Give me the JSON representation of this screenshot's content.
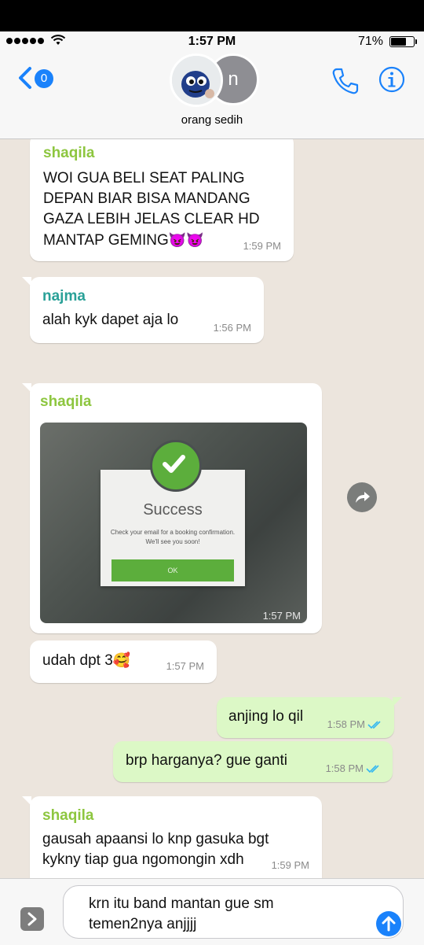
{
  "status_bar": {
    "time": "1:57 PM",
    "battery_percent": "71%",
    "battery_level": 0.71,
    "signal_bars": 5
  },
  "header": {
    "back_count": "0",
    "avatar_initial": "n",
    "group_name": "orang sedih"
  },
  "colors": {
    "accent": "#1a82fb",
    "sender_shaqila": "#8dc63f",
    "sender_najma": "#2aa198",
    "outgoing_bubble": "#dcf8c6",
    "chat_bg": "#ece5dd"
  },
  "messages": [
    {
      "sender": "shaqila",
      "text": "WOI GUA BELI SEAT PALING\nDEPAN BIAR BISA MANDANG\nGAZA LEBIH JELAS CLEAR HD\nMANTAP GEMING",
      "emoji": "😈😈",
      "time": "1:59 PM"
    },
    {
      "sender": "najma",
      "text": "alah kyk dapet aja lo",
      "time": "1:56 PM"
    },
    {
      "sender": "shaqila",
      "type": "image",
      "time": "1:57 PM",
      "image": {
        "title": "Success",
        "message": "Check your email for a booking confirmation. We'll see you soon!",
        "button": "OK",
        "icon": "check-icon"
      }
    },
    {
      "text": "udah dpt 3",
      "emoji": "🥰",
      "time": "1:57 PM"
    },
    {
      "outgoing": true,
      "text": "anjing lo qil",
      "time": "1:58 PM",
      "status": "read"
    },
    {
      "outgoing": true,
      "text": "brp harganya? gue ganti",
      "time": "1:58 PM",
      "status": "read"
    },
    {
      "sender": "shaqila",
      "text": "gausah apaansi lo knp gasuka bgt\nkykny tiap gua ngomongin xdh",
      "time": "1:59 PM"
    }
  ],
  "input": {
    "text": "krn itu band mantan gue sm\ntemen2nya anjjjj"
  }
}
